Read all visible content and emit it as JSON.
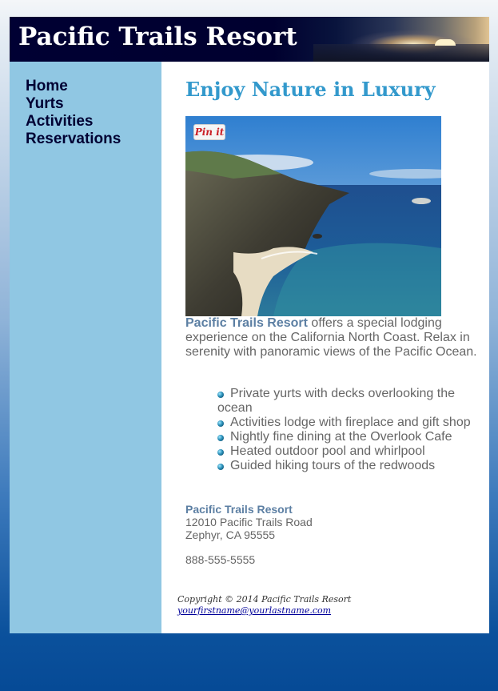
{
  "header": {
    "title": "Pacific Trails Resort"
  },
  "nav": {
    "items": [
      {
        "label": "Home"
      },
      {
        "label": "Yurts"
      },
      {
        "label": "Activities"
      },
      {
        "label": "Reservations"
      }
    ]
  },
  "main": {
    "heading": "Enjoy Nature in Luxury",
    "pin_label": "Pin it",
    "intro_name": "Pacific Trails Resort",
    "intro_text": " offers a special lodging experience on the California North Coast. Relax in serenity with panoramic views of the Pacific Ocean.",
    "features": [
      "Private yurts with decks overlooking the ocean",
      "Activities lodge with fireplace and gift shop",
      "Nightly fine dining at the Overlook Cafe",
      "Heated outdoor pool and whirlpool",
      "Guided hiking tours of the redwoods"
    ],
    "address": {
      "name": "Pacific Trails Resort",
      "street": "12010 Pacific Trails Road",
      "city": "Zephyr, CA 95555"
    },
    "phone": "888-555-5555"
  },
  "footer": {
    "copyright": "Copyright © 2014 Pacific Trails Resort",
    "email": "yourfirstname@yourlastname.com"
  },
  "colors": {
    "header_bg": "#000033",
    "nav_bg": "#90c7e3",
    "heading": "#3399cc",
    "text": "#666666",
    "resort_name": "#5c7fa3"
  }
}
